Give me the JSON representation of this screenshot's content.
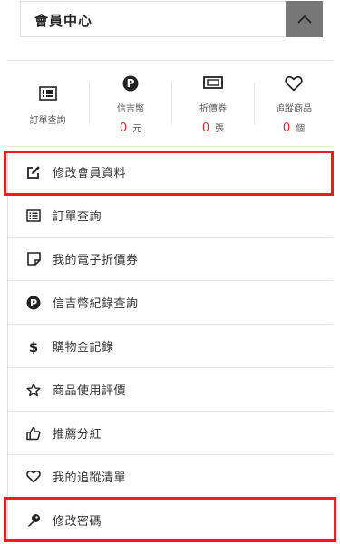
{
  "header": {
    "title": "會員中心"
  },
  "stats": {
    "orders": {
      "label": "訂單查詢"
    },
    "coins": {
      "label": "信吉幣",
      "value": "0",
      "unit": "元"
    },
    "coupons": {
      "label": "折價券",
      "value": "0",
      "unit": "張"
    },
    "wishlist": {
      "label": "追蹤商品",
      "value": "0",
      "unit": "個"
    }
  },
  "menu": {
    "items": [
      {
        "label": "修改會員資料",
        "icon": "edit-icon"
      },
      {
        "label": "訂單查詢",
        "icon": "list-icon"
      },
      {
        "label": "我的電子折價券",
        "icon": "note-icon"
      },
      {
        "label": "信吉幣紀錄查詢",
        "icon": "coin-p-icon"
      },
      {
        "label": "購物金記錄",
        "icon": "dollar-icon"
      },
      {
        "label": "商品使用評價",
        "icon": "star-icon"
      },
      {
        "label": "推薦分紅",
        "icon": "thumbs-up-icon"
      },
      {
        "label": "我的追蹤清單",
        "icon": "heart-icon"
      },
      {
        "label": "修改密碼",
        "icon": "key-icon"
      }
    ]
  },
  "colors": {
    "highlight": "#ee1c1c",
    "value_red": "#d8262e",
    "toggle_bg": "#777777"
  }
}
